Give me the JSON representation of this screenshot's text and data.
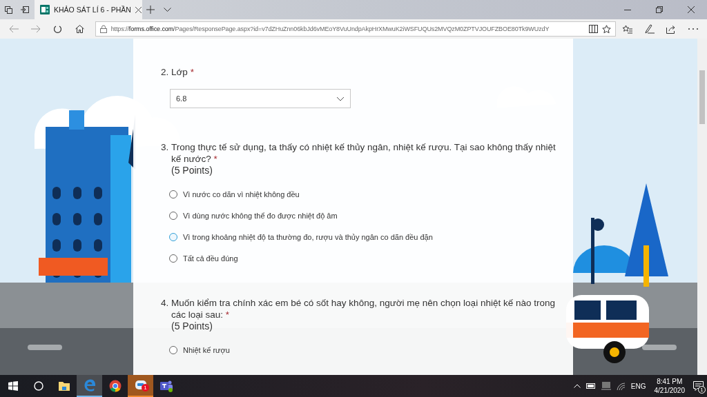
{
  "browser": {
    "tab_title": "KHẢO SÁT LÍ 6 - PHẦN",
    "url_scheme": "https://",
    "url_host": "forms.office.com",
    "url_path": "/Pages/ResponsePage.aspx?id=v7dZHuZnn06kbJd6vMEoY8VuUndpAkpHrXMwuK2iWSFUQUs2MVQzM0ZPTVJOUFZBOE80Tk9WUzdY"
  },
  "questions": [
    {
      "kind": "dropdown",
      "number": "2.",
      "title": "Lớp",
      "required_mark": "*",
      "value": "6.8"
    },
    {
      "kind": "choice",
      "number": "3.",
      "title": "Trong thực tế sử dụng, ta thấy có nhiệt kế thủy ngân, nhiệt kế rượu. Tại sao không thấy nhiệt kế nước?",
      "required_mark": "*",
      "points": "(5 Points)",
      "options": [
        {
          "label": "Vì nước co dãn vì nhiệt không đều",
          "selected": false,
          "hovered": false
        },
        {
          "label": "Vì dùng nước không thể đo được nhiệt độ âm",
          "selected": false,
          "hovered": false
        },
        {
          "label": "Vì trong khoảng nhiệt độ ta thường đo, rượu và thủy ngân co dãn đều đặn",
          "selected": false,
          "hovered": true
        },
        {
          "label": "Tất cả đều đúng",
          "selected": false,
          "hovered": false
        }
      ]
    },
    {
      "kind": "choice",
      "number": "4.",
      "title": "Muốn kiểm tra chính xác em bé có sốt hay không, người mẹ nên chọn loại nhiệt kế nào trong các loại sau:",
      "required_mark": "*",
      "points": "(5 Points)",
      "options": [
        {
          "label": "Nhiệt kế rượu",
          "selected": false,
          "hovered": false
        }
      ]
    }
  ],
  "taskbar": {
    "apps": [
      {
        "kind": "explorer",
        "active": false,
        "highlighted": false
      },
      {
        "kind": "edge",
        "active": true,
        "highlighted": false
      },
      {
        "kind": "chrome",
        "active": false,
        "highlighted": false
      },
      {
        "kind": "chat",
        "active": false,
        "highlighted": true,
        "badge": "1"
      },
      {
        "kind": "teams",
        "active": false,
        "highlighted": false
      }
    ],
    "language": "ENG",
    "time": "8:41 PM",
    "date": "4/21/2020",
    "notifications": "1"
  }
}
